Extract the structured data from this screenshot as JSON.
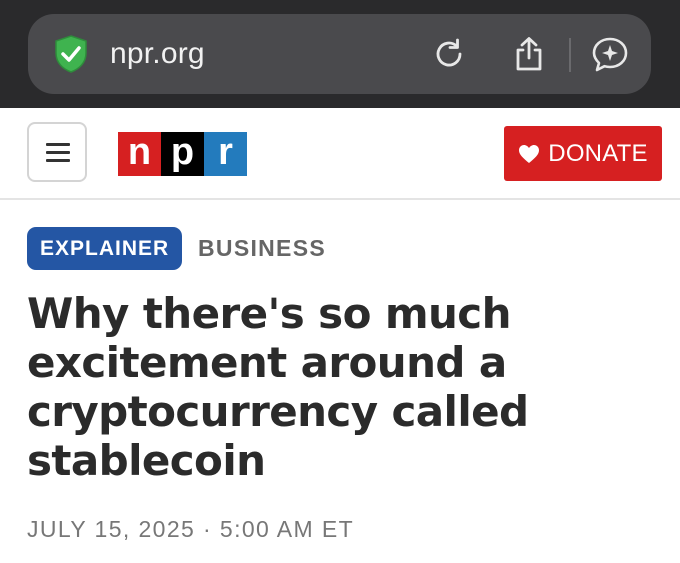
{
  "browser": {
    "url": "npr.org",
    "icons": {
      "security": "shield-check-icon",
      "reload": "reload-icon",
      "share": "share-icon",
      "assistant": "sparkle-chat-icon"
    }
  },
  "header": {
    "menu_icon": "hamburger-menu-icon",
    "logo_letters": [
      "n",
      "p",
      "r"
    ],
    "logo_colors": [
      "#d62021",
      "#000000",
      "#237bbd"
    ],
    "donate_label": "DONATE",
    "donate_icon": "heart-icon"
  },
  "article": {
    "tag": "EXPLAINER",
    "section": "BUSINESS",
    "headline": "Why there's so much excitement around a cryptocurrency called stablecoin",
    "dateline": "JULY 15, 2025 · 5:00 AM ET"
  },
  "colors": {
    "brand_red": "#d62021",
    "explainer_blue": "#2456a4",
    "chrome_bg": "#2a2a2c"
  }
}
